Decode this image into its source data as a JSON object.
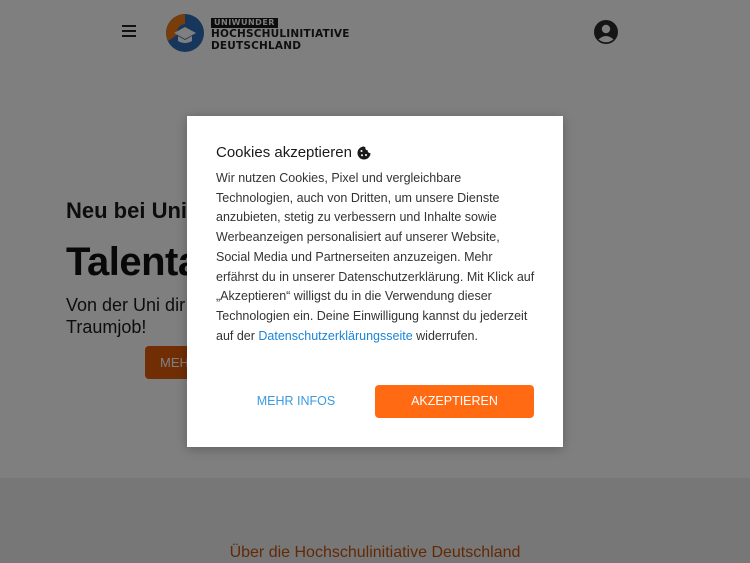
{
  "header": {
    "logo_tag": "UNIWUNDER",
    "logo_line1": "HOCHSCHULINITIATIVE",
    "logo_line2": "DEUTSCHLAND"
  },
  "hero": {
    "kicker": "Neu bei Uni",
    "title": "Talentag",
    "subtitle_line1": "Von der Uni dir",
    "subtitle_line2": "Traumjob!",
    "button_label": "MEHR"
  },
  "about": {
    "title": "Über die Hochschulinitiative Deutschland"
  },
  "cookie_dialog": {
    "title": "Cookies akzeptieren",
    "body_text": "Wir nutzen Cookies, Pixel und vergleichbare Technologien, auch von Dritten, um unsere Dienste anzubieten, stetig zu verbessern und Inhalte sowie Werbeanzeigen personalisiert auf unserer Website, Social Media und Partnerseiten anzuzeigen. Mehr erfährst du in unserer Datenschutzerklärung. Mit Klick auf „Akzeptieren“ willigst du in die Verwendung dieser Technologien ein. Deine Einwilligung kannst du jederzeit auf der",
    "link_text": "Datenschutzerklärungsseite",
    "body_end": "widerrufen.",
    "more_button": "MEHR INFOS",
    "accept_button": "AKZEPTIEREN"
  },
  "colors": {
    "accent": "#ff6a13",
    "link": "#1a84d6",
    "overlay": "rgba(0,0,0,0.5)"
  },
  "icons": {
    "menu": "hamburger-icon",
    "logo": "graduation-cap-logo",
    "account": "user-circle-icon",
    "cookie": "cookie-icon"
  }
}
